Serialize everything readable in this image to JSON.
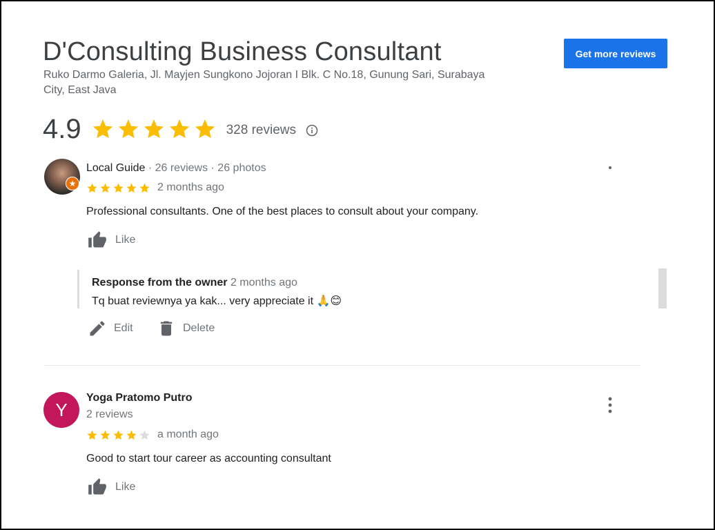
{
  "business": {
    "name": "D'Consulting Business Consultant",
    "address": "Ruko Darmo Galeria, Jl. Mayjen Sungkono Jojoran I Blk. C No.18, Gunung Sari, Surabaya City, East Java"
  },
  "header": {
    "get_more_label": "Get more reviews"
  },
  "summary": {
    "rating": "4.9",
    "stars": 5,
    "review_count": "328 reviews"
  },
  "colors": {
    "star": "#fbbc04",
    "star_empty": "#dadce0",
    "accent": "#1a73e8",
    "avatar_y": "#c2185b"
  },
  "reviews": [
    {
      "author_meta_name": "Local Guide",
      "author_meta_extra": " · 26 reviews · 26 photos",
      "rating": 5,
      "time": "2 months ago",
      "text": "Professional consultants. One of the best places to consult about your company.",
      "like_label": "Like",
      "owner_response": {
        "title": "Response from the owner",
        "time": "2 months ago",
        "text": "Tq buat reviewnya ya kak... very appreciate it 🙏😊"
      },
      "edit_label": "Edit",
      "delete_label": "Delete"
    },
    {
      "author": "Yoga Pratomo Putro",
      "avatar_letter": "Y",
      "author_reviews": "2 reviews",
      "rating": 4,
      "time": "a month ago",
      "text": "Good to start tour career as accounting consultant",
      "like_label": "Like"
    }
  ],
  "icons": {
    "star": "star-icon",
    "info": "info-icon",
    "thumb": "thumb-up-icon",
    "edit": "pencil-icon",
    "delete": "trash-icon",
    "more": "more-vert-icon"
  }
}
